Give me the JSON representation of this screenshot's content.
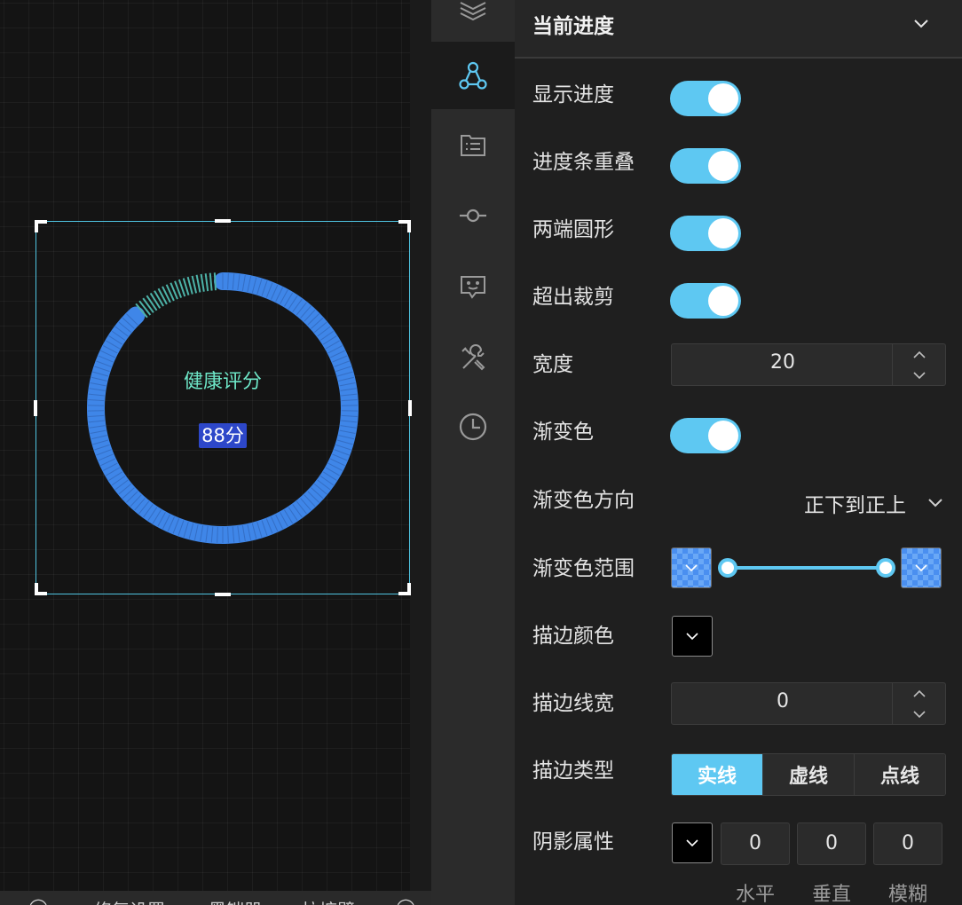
{
  "canvas": {
    "widget": {
      "title": "健康评分",
      "value_label": "88分",
      "progress_percent": 88,
      "progress_color": "#3f86e8",
      "tick_color": "#4db3a8",
      "title_color": "#6ee7c8"
    },
    "bottom_bar": {
      "items": [
        "◯",
        "···",
        "修复设置",
        "黑铠器",
        "拉塘壁",
        "◯"
      ]
    }
  },
  "rail": {
    "items": [
      {
        "icon": "layers-icon",
        "active": false
      },
      {
        "icon": "nodes-icon",
        "active": true
      },
      {
        "icon": "list-file-icon",
        "active": false
      },
      {
        "icon": "commit-icon",
        "active": false
      },
      {
        "icon": "chat-smile-icon",
        "active": false
      },
      {
        "icon": "tools-icon",
        "active": false
      },
      {
        "icon": "clock-icon",
        "active": false
      }
    ]
  },
  "panel": {
    "title": "当前进度",
    "accent": "#5ec8f2",
    "rows": {
      "show_progress": {
        "label": "显示进度",
        "on": true
      },
      "overlap": {
        "label": "进度条重叠",
        "on": true
      },
      "round_cap": {
        "label": "两端圆形",
        "on": true
      },
      "clip": {
        "label": "超出裁剪",
        "on": true
      },
      "width": {
        "label": "宽度",
        "value": "20"
      },
      "gradient": {
        "label": "渐变色",
        "on": true
      },
      "gradient_direction": {
        "label": "渐变色方向",
        "value": "正下到正上"
      },
      "gradient_range": {
        "label": "渐变色范围",
        "start_color": "#4a8ff0",
        "end_color": "#4a8ff0"
      },
      "stroke_color": {
        "label": "描边颜色",
        "color": "#000000"
      },
      "stroke_width": {
        "label": "描边线宽",
        "value": "0"
      },
      "stroke_type": {
        "label": "描边类型",
        "options": [
          "实线",
          "虚线",
          "点线"
        ],
        "selected": "实线"
      },
      "shadow": {
        "label": "阴影属性",
        "color": "#000000",
        "horizontal": "0",
        "vertical": "0",
        "blur": "0",
        "horizontal_label": "水平",
        "vertical_label": "垂直",
        "blur_label": "模糊"
      }
    }
  }
}
